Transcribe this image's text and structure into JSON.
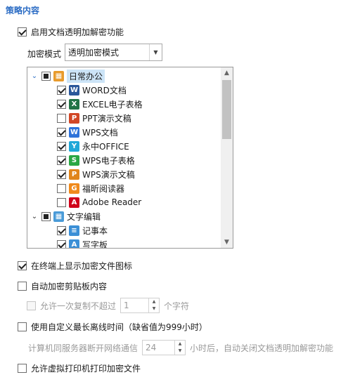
{
  "section_title": "策略内容",
  "enable_transparent": {
    "label": "启用文档透明加解密功能",
    "checked": true
  },
  "encrypt_mode": {
    "label": "加密模式",
    "value": "透明加密模式"
  },
  "tree": {
    "groups": [
      {
        "label": "日常办公",
        "state": "partial",
        "expanded": true,
        "items": [
          {
            "label": "WORD文档",
            "checked": true,
            "icon": "word-icon",
            "color": "#2b579a"
          },
          {
            "label": "EXCEL电子表格",
            "checked": true,
            "icon": "excel-icon",
            "color": "#217346"
          },
          {
            "label": "PPT演示文稿",
            "checked": false,
            "icon": "ppt-icon",
            "color": "#d24726"
          },
          {
            "label": "WPS文档",
            "checked": true,
            "icon": "wps-writer-icon",
            "color": "#2f73d9"
          },
          {
            "label": "永中OFFICE",
            "checked": true,
            "icon": "yozo-icon",
            "color": "#20a8d8"
          },
          {
            "label": "WPS电子表格",
            "checked": true,
            "icon": "wps-sheet-icon",
            "color": "#2aa744"
          },
          {
            "label": "WPS演示文稿",
            "checked": true,
            "icon": "wps-present-icon",
            "color": "#e0851b"
          },
          {
            "label": "福昕阅读器",
            "checked": false,
            "icon": "foxit-icon",
            "color": "#f08a1c"
          },
          {
            "label": "Adobe Reader",
            "checked": false,
            "icon": "adobe-reader-icon",
            "color": "#d0021b"
          }
        ]
      },
      {
        "label": "文字编辑",
        "state": "partial",
        "expanded": true,
        "items": [
          {
            "label": "记事本",
            "checked": true,
            "icon": "notepad-icon",
            "color": "#3b8fd6"
          },
          {
            "label": "写字板",
            "checked": true,
            "icon": "wordpad-icon",
            "color": "#3b8fd6"
          }
        ]
      }
    ]
  },
  "show_icon": {
    "label": "在终端上显示加密文件图标",
    "checked": true
  },
  "auto_clipboard": {
    "label": "自动加密剪贴板内容",
    "checked": false
  },
  "copy_limit": {
    "prefix": "允许一次复制不超过",
    "value": "1",
    "suffix": "个字符",
    "checked": false,
    "disabled": true
  },
  "offline_time": {
    "label": "使用自定义最长离线时间（缺省值为999小时）",
    "checked": false
  },
  "offline_detail": {
    "prefix": "计算机同服务器断开网络通信",
    "value": "24",
    "suffix": "小时后，自动关闭文档透明加解密功能"
  },
  "virtual_printer": {
    "label": "允许虚拟打印机打印加密文件",
    "checked": false
  }
}
